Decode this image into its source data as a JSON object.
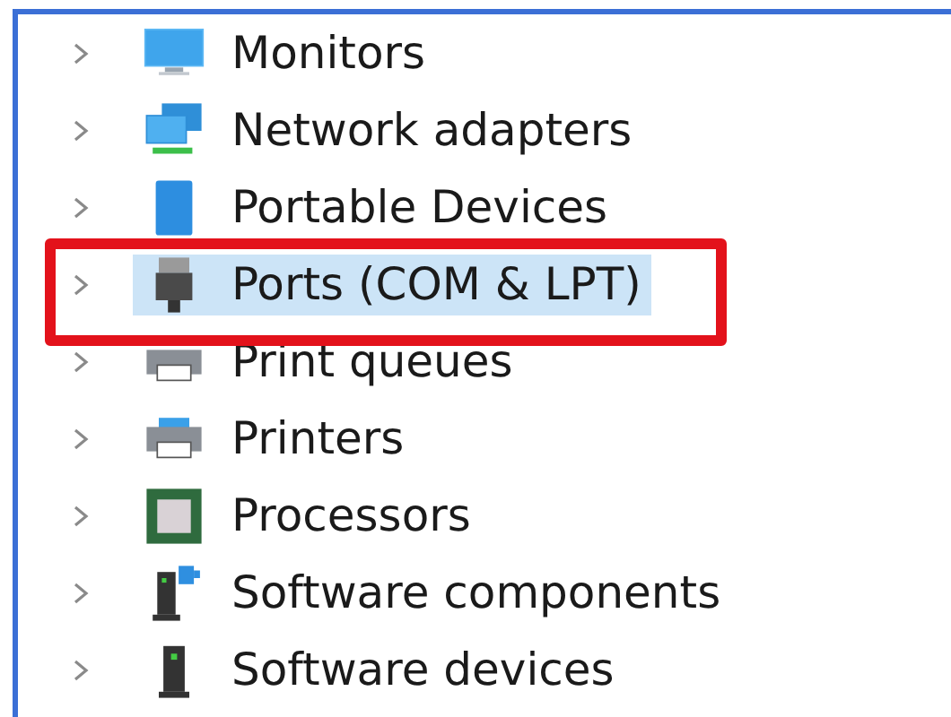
{
  "tree": {
    "items": [
      {
        "label": "Monitors",
        "kind": "monitor",
        "selected": false,
        "annotated": false
      },
      {
        "label": "Network adapters",
        "kind": "network",
        "selected": false,
        "annotated": false
      },
      {
        "label": "Portable Devices",
        "kind": "portable",
        "selected": false,
        "annotated": false
      },
      {
        "label": "Ports (COM & LPT)",
        "kind": "port",
        "selected": true,
        "annotated": true
      },
      {
        "label": "Print queues",
        "kind": "printqueue",
        "selected": false,
        "annotated": false
      },
      {
        "label": "Printers",
        "kind": "printer",
        "selected": false,
        "annotated": false
      },
      {
        "label": "Processors",
        "kind": "processor",
        "selected": false,
        "annotated": false
      },
      {
        "label": "Software components",
        "kind": "swcomponent",
        "selected": false,
        "annotated": false
      },
      {
        "label": "Software devices",
        "kind": "swdevice",
        "selected": false,
        "annotated": false
      }
    ]
  }
}
